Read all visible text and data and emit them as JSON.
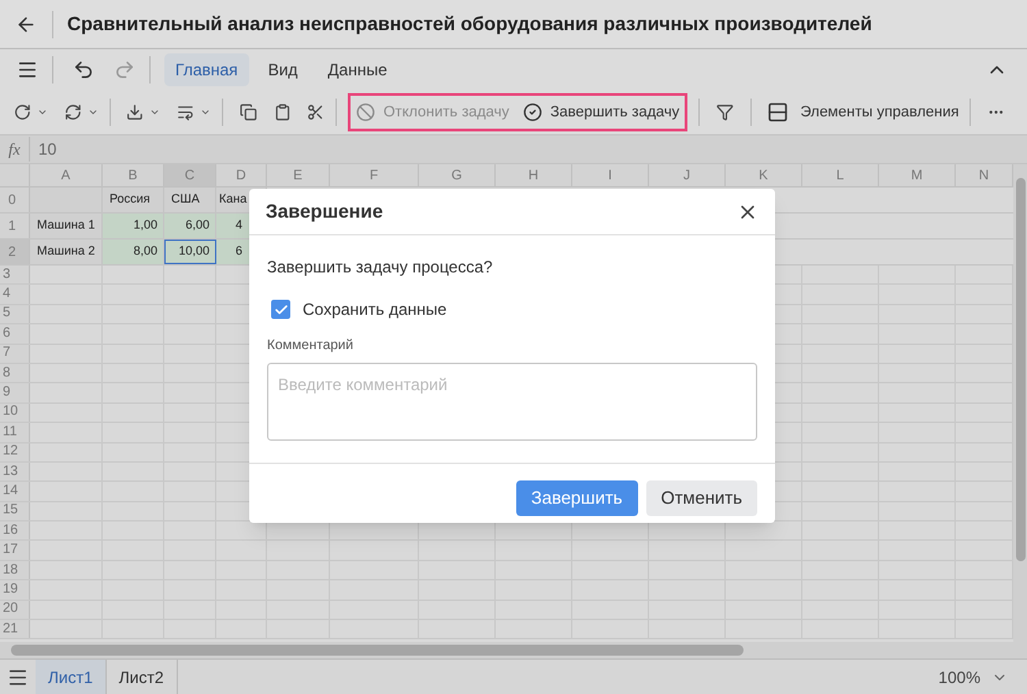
{
  "window": {
    "title": "Сравнительный анализ неисправностей оборудования различных производителей"
  },
  "menu_tabs": [
    {
      "label": "Главная",
      "selected": true
    },
    {
      "label": "Вид",
      "selected": false
    },
    {
      "label": "Данные",
      "selected": false
    }
  ],
  "toolbar": {
    "reject_task": {
      "label": "Отклонить задачу",
      "disabled": true
    },
    "complete_task": {
      "label": "Завершить задачу",
      "disabled": false
    },
    "controls": {
      "label": "Элементы управления"
    }
  },
  "formula_bar": {
    "label": "fx",
    "value": "10"
  },
  "columns": [
    {
      "label": "A",
      "selected": false
    },
    {
      "label": "B",
      "selected": false
    },
    {
      "label": "C",
      "selected": true
    },
    {
      "label": "D",
      "selected": false
    },
    {
      "label": "E",
      "selected": false
    },
    {
      "label": "F",
      "selected": false
    },
    {
      "label": "G",
      "selected": false
    },
    {
      "label": "H",
      "selected": false
    },
    {
      "label": "I",
      "selected": false
    },
    {
      "label": "J",
      "selected": false
    },
    {
      "label": "K",
      "selected": false
    },
    {
      "label": "L",
      "selected": false
    },
    {
      "label": "M",
      "selected": false
    },
    {
      "label": "N",
      "selected": false
    }
  ],
  "data_rows": [
    {
      "header": "0",
      "selected": false,
      "cells": [
        {
          "text": "",
          "in_range": false,
          "selected": false
        },
        {
          "text": "Россия",
          "in_range": false,
          "selected": false
        },
        {
          "text": "США",
          "in_range": false,
          "selected": false
        },
        {
          "text": "Кана",
          "in_range": false,
          "selected": false
        }
      ]
    },
    {
      "header": "1",
      "selected": false,
      "cells": [
        {
          "text": "Машина 1",
          "in_range": false,
          "selected": false
        },
        {
          "text": "1,00",
          "in_range": true,
          "selected": false
        },
        {
          "text": "6,00",
          "in_range": true,
          "selected": false
        },
        {
          "text": "4",
          "in_range": true,
          "selected": false
        }
      ]
    },
    {
      "header": "2",
      "selected": true,
      "cells": [
        {
          "text": "Машина 2",
          "in_range": false,
          "selected": false
        },
        {
          "text": "8,00",
          "in_range": true,
          "selected": false
        },
        {
          "text": "10,00",
          "in_range": true,
          "selected": true
        },
        {
          "text": "6",
          "in_range": true,
          "selected": false
        }
      ]
    }
  ],
  "empty_rows": [
    "3",
    "4",
    "5",
    "6",
    "7",
    "8",
    "9",
    "10",
    "11",
    "12",
    "13",
    "14",
    "15",
    "16",
    "17",
    "18",
    "19",
    "20",
    "21"
  ],
  "dialog": {
    "title": "Завершение",
    "question": "Завершить задачу процесса?",
    "checkbox": {
      "label": "Сохранить данные",
      "checked": true
    },
    "comment_label": "Комментарий",
    "comment": {
      "placeholder": "Введите комментарий"
    },
    "buttons": [
      {
        "label": "Завершить",
        "kind": "primary"
      },
      {
        "label": "Отменить",
        "kind": "secondary"
      }
    ]
  },
  "sheets": [
    {
      "label": "Лист1",
      "selected": true
    },
    {
      "label": "Лист2",
      "selected": false
    }
  ],
  "zoom": "100%"
}
